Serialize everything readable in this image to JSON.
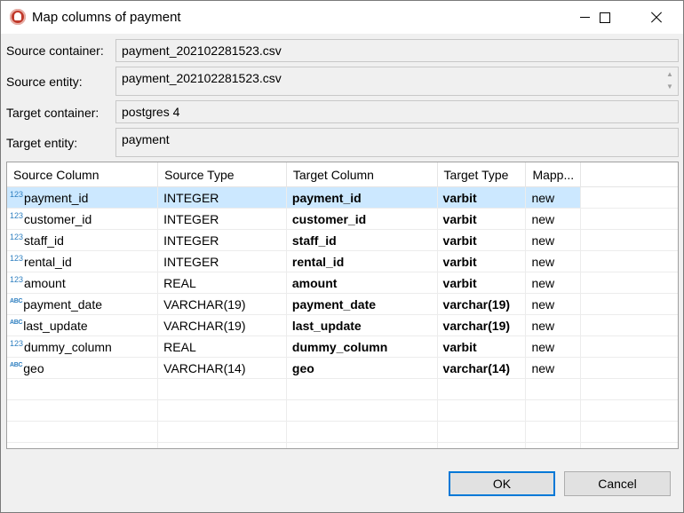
{
  "window": {
    "title": "Map columns of payment"
  },
  "fields": {
    "source_container": {
      "label": "Source container:",
      "value": "payment_202102281523.csv"
    },
    "source_entity": {
      "label": "Source entity:",
      "value": "payment_202102281523.csv"
    },
    "target_container": {
      "label": "Target container:",
      "value": "postgres 4"
    },
    "target_entity": {
      "label": "Target entity:",
      "value": "payment"
    }
  },
  "table": {
    "headers": [
      "Source Column",
      "Source Type",
      "Target Column",
      "Target Type",
      "Mapp..."
    ],
    "rows": [
      {
        "icon": "123",
        "source_column": "payment_id",
        "source_type": "INTEGER",
        "target_column": "payment_id",
        "target_type": "varbit",
        "mapping": "new"
      },
      {
        "icon": "123",
        "source_column": "customer_id",
        "source_type": "INTEGER",
        "target_column": "customer_id",
        "target_type": "varbit",
        "mapping": "new"
      },
      {
        "icon": "123",
        "source_column": "staff_id",
        "source_type": "INTEGER",
        "target_column": "staff_id",
        "target_type": "varbit",
        "mapping": "new"
      },
      {
        "icon": "123",
        "source_column": "rental_id",
        "source_type": "INTEGER",
        "target_column": "rental_id",
        "target_type": "varbit",
        "mapping": "new"
      },
      {
        "icon": "123",
        "source_column": "amount",
        "source_type": "REAL",
        "target_column": "amount",
        "target_type": "varbit",
        "mapping": "new"
      },
      {
        "icon": "ABC",
        "source_column": "payment_date",
        "source_type": "VARCHAR(19)",
        "target_column": "payment_date",
        "target_type": "varchar(19)",
        "mapping": "new"
      },
      {
        "icon": "ABC",
        "source_column": "last_update",
        "source_type": "VARCHAR(19)",
        "target_column": "last_update",
        "target_type": "varchar(19)",
        "mapping": "new"
      },
      {
        "icon": "123",
        "source_column": "dummy_column",
        "source_type": "REAL",
        "target_column": "dummy_column",
        "target_type": "varbit",
        "mapping": "new"
      },
      {
        "icon": "ABC",
        "source_column": "geo",
        "source_type": "VARCHAR(14)",
        "target_column": "geo",
        "target_type": "varchar(14)",
        "mapping": "new"
      }
    ]
  },
  "buttons": {
    "ok": "OK",
    "cancel": "Cancel"
  },
  "colors": {
    "selection": "#cce8ff",
    "default_button_border": "#0078d7",
    "type_icon": "#2e7fc0"
  }
}
